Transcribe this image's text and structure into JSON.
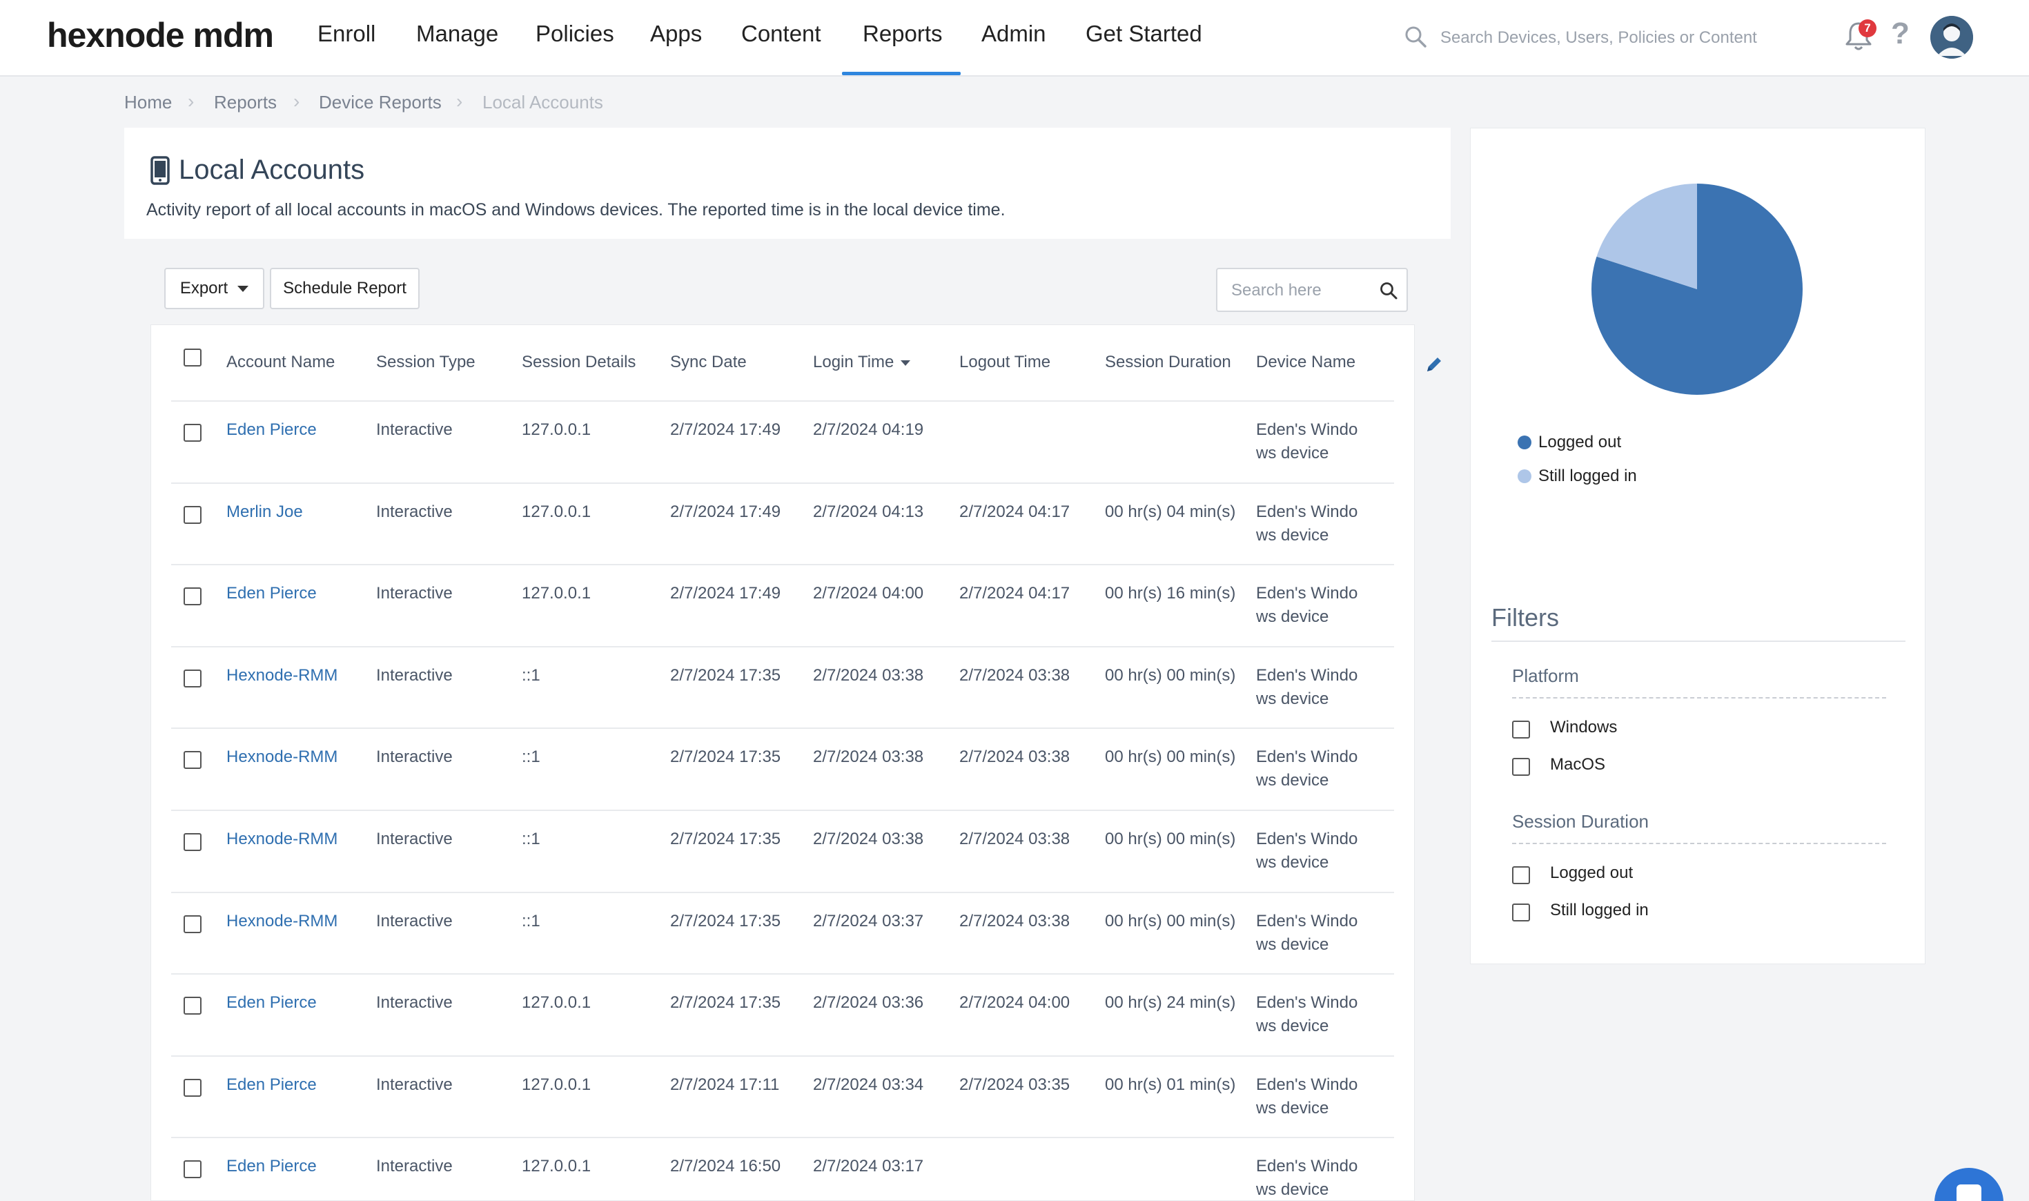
{
  "brand": {
    "logo_text": "hexnode mdm"
  },
  "nav": {
    "items": [
      "Enroll",
      "Manage",
      "Policies",
      "Apps",
      "Content",
      "Reports",
      "Admin",
      "Get Started"
    ],
    "active": "Reports",
    "search_placeholder": "Search Devices, Users, Policies or Content",
    "notification_count": "7",
    "help_glyph": "?"
  },
  "breadcrumb": [
    "Home",
    "Reports",
    "Device Reports",
    "Local Accounts"
  ],
  "page": {
    "title": "Local Accounts",
    "description": "Activity report of all local accounts in macOS and Windows devices. The reported time is in the local device time."
  },
  "toolbar": {
    "export_label": "Export",
    "schedule_label": "Schedule Report",
    "search_placeholder": "Search here"
  },
  "table": {
    "columns": [
      "Account Name",
      "Session Type",
      "Session Details",
      "Sync Date",
      "Login Time",
      "Logout Time",
      "Session Duration",
      "Device Name"
    ],
    "sorted_column": "Login Time",
    "rows": [
      {
        "account": "Eden Pierce",
        "type": "Interactive",
        "details": "127.0.0.1",
        "sync": "2/7/2024 17:49",
        "login": "2/7/2024 04:19",
        "logout": "",
        "duration": "",
        "device": "Eden's Windo ws device"
      },
      {
        "account": "Merlin Joe",
        "type": "Interactive",
        "details": "127.0.0.1",
        "sync": "2/7/2024 17:49",
        "login": "2/7/2024 04:13",
        "logout": "2/7/2024 04:17",
        "duration": "00 hr(s) 04 min(s)",
        "device": "Eden's Windo ws device"
      },
      {
        "account": "Eden Pierce",
        "type": "Interactive",
        "details": "127.0.0.1",
        "sync": "2/7/2024 17:49",
        "login": "2/7/2024 04:00",
        "logout": "2/7/2024 04:17",
        "duration": "00 hr(s) 16 min(s)",
        "device": "Eden's Windo ws device"
      },
      {
        "account": "Hexnode-RMM",
        "type": "Interactive",
        "details": "::1",
        "sync": "2/7/2024 17:35",
        "login": "2/7/2024 03:38",
        "logout": "2/7/2024 03:38",
        "duration": "00 hr(s) 00 min(s)",
        "device": "Eden's Windo ws device"
      },
      {
        "account": "Hexnode-RMM",
        "type": "Interactive",
        "details": "::1",
        "sync": "2/7/2024 17:35",
        "login": "2/7/2024 03:38",
        "logout": "2/7/2024 03:38",
        "duration": "00 hr(s) 00 min(s)",
        "device": "Eden's Windo ws device"
      },
      {
        "account": "Hexnode-RMM",
        "type": "Interactive",
        "details": "::1",
        "sync": "2/7/2024 17:35",
        "login": "2/7/2024 03:38",
        "logout": "2/7/2024 03:38",
        "duration": "00 hr(s) 00 min(s)",
        "device": "Eden's Windo ws device"
      },
      {
        "account": "Hexnode-RMM",
        "type": "Interactive",
        "details": "::1",
        "sync": "2/7/2024 17:35",
        "login": "2/7/2024 03:37",
        "logout": "2/7/2024 03:38",
        "duration": "00 hr(s) 00 min(s)",
        "device": "Eden's Windo ws device"
      },
      {
        "account": "Eden Pierce",
        "type": "Interactive",
        "details": "127.0.0.1",
        "sync": "2/7/2024 17:35",
        "login": "2/7/2024 03:36",
        "logout": "2/7/2024 04:00",
        "duration": "00 hr(s) 24 min(s)",
        "device": "Eden's Windo ws device"
      },
      {
        "account": "Eden Pierce",
        "type": "Interactive",
        "details": "127.0.0.1",
        "sync": "2/7/2024 17:11",
        "login": "2/7/2024 03:34",
        "logout": "2/7/2024 03:35",
        "duration": "00 hr(s) 01 min(s)",
        "device": "Eden's Windo ws device"
      },
      {
        "account": "Eden Pierce",
        "type": "Interactive",
        "details": "127.0.0.1",
        "sync": "2/7/2024 16:50",
        "login": "2/7/2024 03:17",
        "logout": "",
        "duration": "",
        "device": "Eden's Windo ws device"
      }
    ]
  },
  "chart_data": {
    "type": "pie",
    "slices": [
      {
        "label": "Logged out",
        "value": 8,
        "color": "#3b73b2"
      },
      {
        "label": "Still logged in",
        "value": 2,
        "color": "#aec6e8"
      }
    ]
  },
  "filters": {
    "title": "Filters",
    "groups": [
      {
        "name": "Platform",
        "options": [
          "Windows",
          "MacOS"
        ]
      },
      {
        "name": "Session Duration",
        "options": [
          "Logged out",
          "Still logged in"
        ]
      }
    ]
  },
  "colors": {
    "accent": "#2e86de",
    "link": "#2f6fb0",
    "badge": "#e0393e"
  }
}
